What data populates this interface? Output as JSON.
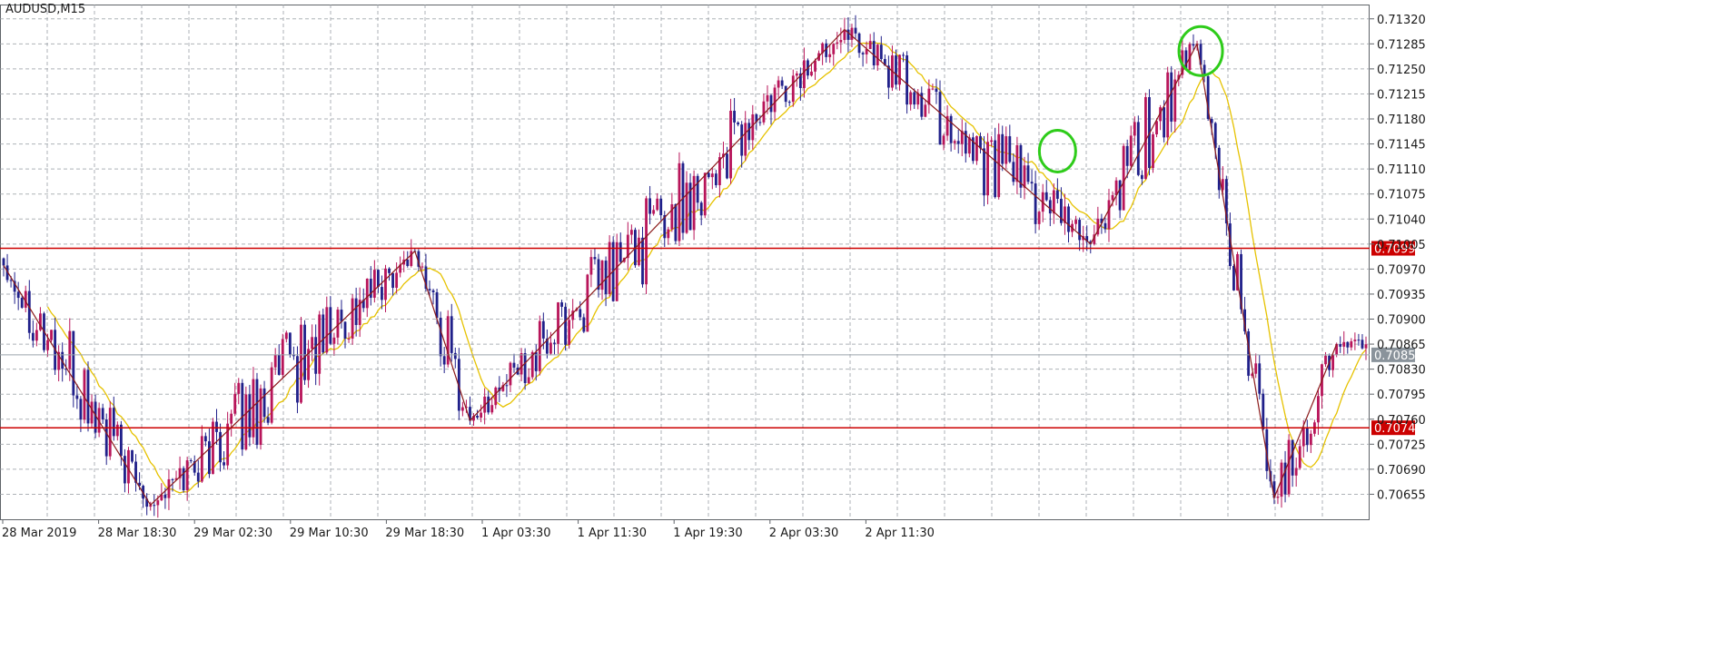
{
  "window": {
    "symbol_label": "AUDUSD,M15"
  },
  "colors": {
    "background": "#ffffff",
    "grid": "#9aa0a6",
    "axis": "#5f6368",
    "bull_candle": "#b8155a",
    "bear_candle": "#20208a",
    "moving_average": "#e6c200",
    "zigzag": "#8b1a1a",
    "support_resistance": "#cc0000",
    "bid_line": "#9aa3ab",
    "annotation_circle": "#2ecc1a"
  },
  "horizontal_levels": [
    {
      "price": 0.70999,
      "label": "0.70999",
      "kind": "resistance"
    },
    {
      "price": 0.70748,
      "label": "0.70748",
      "kind": "support"
    }
  ],
  "bid_price": {
    "price": 0.7085,
    "label": "0.70850"
  },
  "chart_data": {
    "type": "candlestick",
    "title": "AUDUSD,M15",
    "ylim": [
      0.7062,
      0.7134
    ],
    "y_ticks": [
      "0.71320",
      "0.71285",
      "0.71250",
      "0.71215",
      "0.71180",
      "0.71145",
      "0.71110",
      "0.71075",
      "0.71040",
      "0.71005",
      "0.70970",
      "0.70935",
      "0.70900",
      "0.70865",
      "0.70830",
      "0.70795",
      "0.70760",
      "0.70725",
      "0.70690",
      "0.70655"
    ],
    "x_ticks": [
      "28 Mar 2019",
      "28 Mar 18:30",
      "29 Mar 02:30",
      "29 Mar 10:30",
      "29 Mar 18:30",
      "1 Apr 03:30",
      "1 Apr 11:30",
      "1 Apr 19:30",
      "2 Apr 03:30",
      "2 Apr 11:30"
    ],
    "grid": true,
    "zigzag": [
      {
        "bar": 0,
        "price": 0.70975
      },
      {
        "bar": 40,
        "price": 0.7064
      },
      {
        "bar": 112,
        "price": 0.70995
      },
      {
        "bar": 127,
        "price": 0.70758
      },
      {
        "bar": 229,
        "price": 0.71305
      },
      {
        "bar": 296,
        "price": 0.71005
      },
      {
        "bar": 325,
        "price": 0.71285
      },
      {
        "bar": 346,
        "price": 0.7065
      },
      {
        "bar": 363,
        "price": 0.70865
      }
    ],
    "annotations": [
      {
        "type": "circle",
        "bar": 287,
        "price": 0.71135
      },
      {
        "type": "circle",
        "bar": 326,
        "price": 0.71275
      }
    ]
  }
}
